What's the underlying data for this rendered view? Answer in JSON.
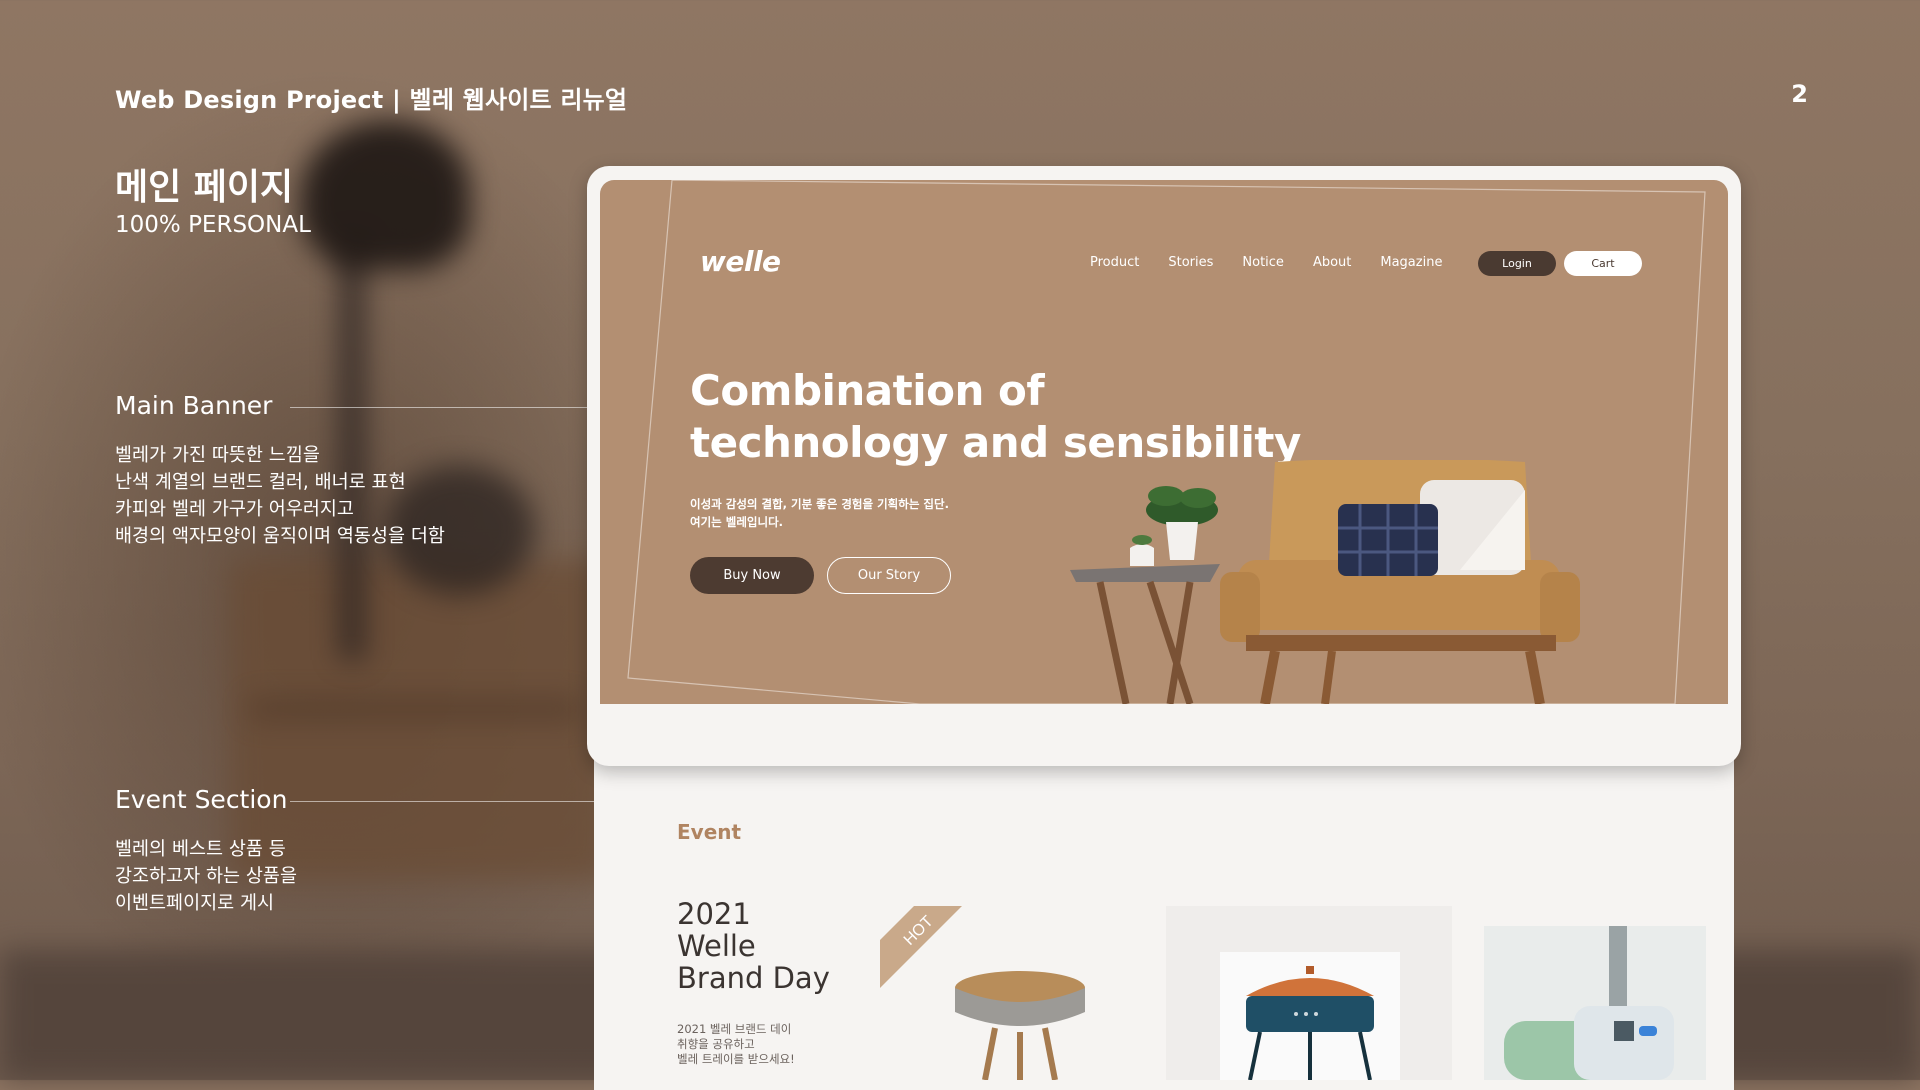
{
  "slide": {
    "header_title": "Web Design Project  |  벨레 웹사이트 리뉴얼",
    "page_number": "2",
    "section_title": "메인 페이지",
    "section_subtitle": "100% PERSONAL"
  },
  "annotations": [
    {
      "title": "Main Banner",
      "lines": [
        "벨레가 가진 따뜻한 느낌을",
        "난색 계열의 브랜드 컬러, 배너로 표현",
        "카피와 벨레 가구가 어우러지고",
        "배경의 액자모양이 움직이며 역동성을 더함"
      ]
    },
    {
      "title": "Event Section",
      "lines": [
        "벨레의 베스트 상품 등",
        "강조하고자 하는 상품을",
        "이벤트페이지로 게시"
      ]
    }
  ],
  "mockup": {
    "logo": "welle",
    "nav": [
      "Product",
      "Stories",
      "Notice",
      "About",
      "Magazine"
    ],
    "login_label": "Login",
    "cart_label": "Cart",
    "headline_line1": "Combination of",
    "headline_line2": "technology and sensibility",
    "description_line1": "이성과 감성의 결합, 기분 좋은 경험을 기획하는 집단.",
    "description_line2": "여기는 벨레입니다.",
    "buy_now_label": "Buy Now",
    "our_story_label": "Our Story",
    "event": {
      "label": "Event",
      "title_lines": [
        "2021",
        "Welle",
        "Brand Day"
      ],
      "desc_lines": [
        "2021 벨레 브랜드 데이",
        "취향을 공유하고",
        "벨레 트레이를 받으세요!"
      ],
      "tag": "HOT"
    }
  },
  "colors": {
    "banner_brown": "#b38f72",
    "button_dark": "#4d3b31",
    "event_accent": "#b08461"
  }
}
